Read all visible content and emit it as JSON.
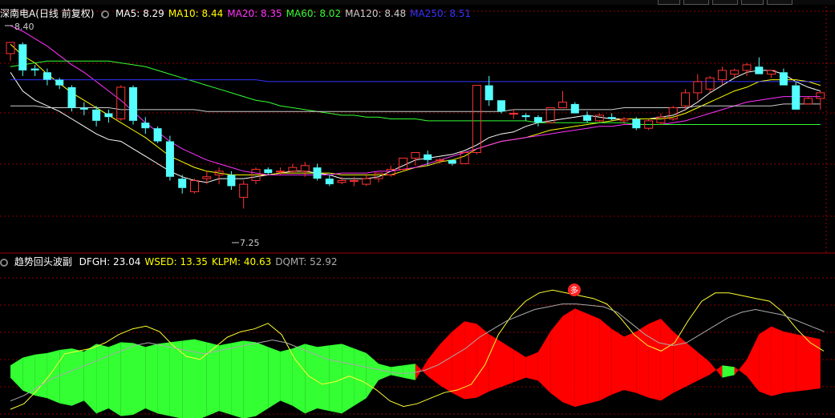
{
  "main_panel": {
    "title": "深南电A(日线 前复权)",
    "indicators": [
      {
        "label": "MA5: 8.29",
        "color": "#ffffff"
      },
      {
        "label": "MA10: 8.44",
        "color": "#ffff00"
      },
      {
        "label": "MA20: 8.35",
        "color": "#ff33ff"
      },
      {
        "label": "MA60: 8.02",
        "color": "#33ff33"
      },
      {
        "label": "MA120: 8.48",
        "color": "#cccccc"
      },
      {
        "label": "MA250: 8.51",
        "color": "#3333ff"
      }
    ],
    "high_label": "8.40",
    "low_label": "7.25"
  },
  "sub_panel": {
    "title": "趋势回头波副",
    "indicators": [
      {
        "label": "DFGH: 23.04",
        "color": "#ffffff"
      },
      {
        "label": "WSED: 13.35",
        "color": "#ffff00"
      },
      {
        "label": "KLPM: 40.63",
        "color": "#ffff00"
      },
      {
        "label": "DQMT: 52.92",
        "color": "#aaaaaa"
      }
    ],
    "marker_glyph": "多"
  },
  "colors": {
    "up": "#ff3333",
    "down": "#54ffff",
    "grid": "#8b0000",
    "pos_fill": "#ff0000",
    "neg_fill": "#33ff33"
  },
  "chart_data": {
    "type": "candlestick",
    "price_range": [
      7.25,
      8.4
    ],
    "candles": [
      [
        8.25,
        8.31,
        8.21,
        8.31
      ],
      [
        8.3,
        8.31,
        8.13,
        8.16
      ],
      [
        8.17,
        8.19,
        8.13,
        8.16
      ],
      [
        8.15,
        8.17,
        8.08,
        8.11
      ],
      [
        8.11,
        8.12,
        8.06,
        8.08
      ],
      [
        8.07,
        8.08,
        7.94,
        7.96
      ],
      [
        7.96,
        7.99,
        7.92,
        7.95
      ],
      [
        7.95,
        7.97,
        7.86,
        7.89
      ],
      [
        7.93,
        7.95,
        7.88,
        7.91
      ],
      [
        7.9,
        8.08,
        7.89,
        8.07
      ],
      [
        8.07,
        8.08,
        7.87,
        7.89
      ],
      [
        7.88,
        7.91,
        7.82,
        7.85
      ],
      [
        7.85,
        7.86,
        7.77,
        7.78
      ],
      [
        7.78,
        7.81,
        7.57,
        7.59
      ],
      [
        7.58,
        7.6,
        7.5,
        7.53
      ],
      [
        7.51,
        7.58,
        7.5,
        7.57
      ],
      [
        7.58,
        7.62,
        7.55,
        7.59
      ],
      [
        7.6,
        7.64,
        7.55,
        7.62
      ],
      [
        7.6,
        7.62,
        7.52,
        7.54
      ],
      [
        7.48,
        7.57,
        7.42,
        7.55
      ],
      [
        7.57,
        7.64,
        7.55,
        7.63
      ],
      [
        7.63,
        7.64,
        7.6,
        7.61
      ],
      [
        7.62,
        7.64,
        7.6,
        7.62
      ],
      [
        7.62,
        7.66,
        7.61,
        7.64
      ],
      [
        7.62,
        7.67,
        7.59,
        7.65
      ],
      [
        7.64,
        7.66,
        7.57,
        7.58
      ],
      [
        7.58,
        7.6,
        7.54,
        7.55
      ],
      [
        7.56,
        7.59,
        7.55,
        7.57
      ],
      [
        7.57,
        7.59,
        7.54,
        7.57
      ],
      [
        7.55,
        7.6,
        7.54,
        7.58
      ],
      [
        7.58,
        7.61,
        7.56,
        7.61
      ],
      [
        7.6,
        7.65,
        7.59,
        7.63
      ],
      [
        7.63,
        7.69,
        7.62,
        7.69
      ],
      [
        7.69,
        7.72,
        7.65,
        7.72
      ],
      [
        7.71,
        7.73,
        7.65,
        7.68
      ],
      [
        7.68,
        7.69,
        7.66,
        7.68
      ],
      [
        7.68,
        7.68,
        7.65,
        7.66
      ],
      [
        7.66,
        7.72,
        7.66,
        7.72
      ],
      [
        7.72,
        8.08,
        7.71,
        8.08
      ],
      [
        8.08,
        8.13,
        7.97,
        8.0
      ],
      [
        8.0,
        8.0,
        7.93,
        7.94
      ],
      [
        7.93,
        7.95,
        7.9,
        7.93
      ],
      [
        7.92,
        7.93,
        7.89,
        7.91
      ],
      [
        7.91,
        7.92,
        7.86,
        7.88
      ],
      [
        7.88,
        7.96,
        7.88,
        7.96
      ],
      [
        7.96,
        8.05,
        7.96,
        7.99
      ],
      [
        7.98,
        7.99,
        7.93,
        7.93
      ],
      [
        7.92,
        7.94,
        7.88,
        7.89
      ],
      [
        7.89,
        7.93,
        7.88,
        7.92
      ],
      [
        7.91,
        7.93,
        7.89,
        7.9
      ],
      [
        7.89,
        7.91,
        7.87,
        7.9
      ],
      [
        7.9,
        7.91,
        7.84,
        7.85
      ],
      [
        7.85,
        7.9,
        7.84,
        7.89
      ],
      [
        7.88,
        7.93,
        7.87,
        7.91
      ],
      [
        7.9,
        7.97,
        7.89,
        7.96
      ],
      [
        7.97,
        8.06,
        7.95,
        8.04
      ],
      [
        8.04,
        8.14,
        8.0,
        8.1
      ],
      [
        8.06,
        8.13,
        8.04,
        8.12
      ],
      [
        8.11,
        8.18,
        8.08,
        8.16
      ],
      [
        8.14,
        8.17,
        8.12,
        8.16
      ],
      [
        8.16,
        8.2,
        8.13,
        8.19
      ],
      [
        8.18,
        8.23,
        8.14,
        8.14
      ],
      [
        8.14,
        8.16,
        8.12,
        8.16
      ],
      [
        8.15,
        8.17,
        8.08,
        8.08
      ],
      [
        8.08,
        8.1,
        7.97,
        7.95
      ],
      [
        7.98,
        8.02,
        7.98,
        8.01
      ],
      [
        8.01,
        8.05,
        7.95,
        8.04
      ]
    ],
    "moving_averages": {
      "MA5": [
        8.15,
        8.05,
        8.0,
        7.97,
        7.94,
        7.9,
        7.86,
        7.82,
        7.79,
        7.78,
        7.74,
        7.7,
        7.66,
        7.62,
        7.59,
        7.57,
        7.56,
        7.58,
        7.58,
        7.58,
        7.59,
        7.6,
        7.61,
        7.62,
        7.62,
        7.61,
        7.6,
        7.58,
        7.58,
        7.58,
        7.59,
        7.62,
        7.65,
        7.68,
        7.69,
        7.7,
        7.71,
        7.73,
        7.76,
        7.8,
        7.82,
        7.83,
        7.86,
        7.88,
        7.89,
        7.9,
        7.91,
        7.92,
        7.91,
        7.9,
        7.9,
        7.9,
        7.9,
        7.91,
        7.92,
        7.95,
        7.99,
        8.04,
        8.08,
        8.12,
        8.15,
        8.16,
        8.16,
        8.14,
        8.1,
        8.07,
        8.05
      ],
      "MA10": [
        8.3,
        8.24,
        8.2,
        8.14,
        8.09,
        8.04,
        8.0,
        7.96,
        7.92,
        7.88,
        7.84,
        7.8,
        7.75,
        7.7,
        7.67,
        7.64,
        7.62,
        7.61,
        7.6,
        7.6,
        7.6,
        7.6,
        7.61,
        7.61,
        7.61,
        7.61,
        7.61,
        7.6,
        7.6,
        7.6,
        7.6,
        7.6,
        7.62,
        7.64,
        7.65,
        7.67,
        7.68,
        7.7,
        7.74,
        7.76,
        7.78,
        7.79,
        7.8,
        7.82,
        7.84,
        7.85,
        7.86,
        7.87,
        7.88,
        7.89,
        7.9,
        7.9,
        7.9,
        7.9,
        7.91,
        7.93,
        7.96,
        7.99,
        8.02,
        8.05,
        8.07,
        8.1,
        8.11,
        8.11,
        8.11,
        8.1,
        8.08
      ],
      "MA20": [
        8.4,
        8.37,
        8.33,
        8.29,
        8.24,
        8.19,
        8.15,
        8.1,
        8.05,
        8.0,
        7.94,
        7.88,
        7.83,
        7.78,
        7.74,
        7.71,
        7.68,
        7.66,
        7.64,
        7.62,
        7.61,
        7.6,
        7.6,
        7.6,
        7.6,
        7.6,
        7.6,
        7.61,
        7.61,
        7.61,
        7.62,
        7.62,
        7.63,
        7.64,
        7.66,
        7.68,
        7.7,
        7.72,
        7.74,
        7.76,
        7.78,
        7.79,
        7.8,
        7.81,
        7.82,
        7.83,
        7.84,
        7.85,
        7.86,
        7.86,
        7.87,
        7.87,
        7.87,
        7.87,
        7.88,
        7.89,
        7.91,
        7.93,
        7.95,
        7.97,
        7.99,
        8.0,
        8.01,
        8.02,
        8.02,
        8.02,
        8.02
      ],
      "MA60": [
        8.18,
        8.19,
        8.2,
        8.21,
        8.21,
        8.21,
        8.21,
        8.21,
        8.21,
        8.2,
        8.19,
        8.18,
        8.16,
        8.14,
        8.12,
        8.1,
        8.08,
        8.06,
        8.04,
        8.02,
        8.0,
        7.99,
        7.97,
        7.96,
        7.95,
        7.94,
        7.93,
        7.92,
        7.92,
        7.91,
        7.91,
        7.9,
        7.9,
        7.9,
        7.89,
        7.89,
        7.89,
        7.89,
        7.89,
        7.89,
        7.89,
        7.89,
        7.89,
        7.88,
        7.88,
        7.88,
        7.88,
        7.88,
        7.88,
        7.88,
        7.88,
        7.87,
        7.87,
        7.87,
        7.87,
        7.87,
        7.87,
        7.87,
        7.87,
        7.87,
        7.87,
        7.87,
        7.87,
        7.87,
        7.87,
        7.87,
        7.87
      ],
      "MA120": [
        7.97,
        7.97,
        7.97,
        7.96,
        7.96,
        7.96,
        7.96,
        7.96,
        7.96,
        7.95,
        7.95,
        7.95,
        7.95,
        7.95,
        7.95,
        7.95,
        7.94,
        7.94,
        7.94,
        7.94,
        7.94,
        7.94,
        7.94,
        7.94,
        7.94,
        7.94,
        7.94,
        7.94,
        7.94,
        7.94,
        7.94,
        7.94,
        7.94,
        7.94,
        7.94,
        7.94,
        7.94,
        7.94,
        7.94,
        7.94,
        7.94,
        7.95,
        7.95,
        7.95,
        7.95,
        7.95,
        7.95,
        7.95,
        7.95,
        7.95,
        7.96,
        7.96,
        7.96,
        7.96,
        7.96,
        7.96,
        7.97,
        7.97,
        7.97,
        7.97,
        7.97,
        7.97,
        7.97,
        7.98,
        7.98,
        7.98,
        7.98
      ],
      "MA250": [
        8.11,
        8.11,
        8.11,
        8.11,
        8.11,
        8.11,
        8.11,
        8.11,
        8.11,
        8.11,
        8.11,
        8.11,
        8.11,
        8.11,
        8.11,
        8.11,
        8.11,
        8.11,
        8.11,
        8.11,
        8.11,
        8.1,
        8.1,
        8.1,
        8.1,
        8.1,
        8.1,
        8.1,
        8.1,
        8.1,
        8.1,
        8.1,
        8.1,
        8.1,
        8.1,
        8.1,
        8.1,
        8.1,
        8.1,
        8.1,
        8.1,
        8.1,
        8.1,
        8.1,
        8.1,
        8.1,
        8.1,
        8.1,
        8.1,
        8.1,
        8.1,
        8.1,
        8.1,
        8.1,
        8.1,
        8.1,
        8.1,
        8.1,
        8.1,
        8.1,
        8.1,
        8.1,
        8.1,
        8.1,
        8.1,
        8.1,
        8.1
      ]
    },
    "oscillator": {
      "range": [
        0,
        100
      ],
      "histogram": [
        -6,
        -16,
        -20,
        -22,
        -26,
        -28,
        -24,
        -34,
        -30,
        -36,
        -35,
        -30,
        -34,
        -36,
        -38,
        -40,
        -36,
        -32,
        -35,
        -38,
        -36,
        -30,
        -24,
        -28,
        -34,
        -30,
        -32,
        -34,
        -28,
        -22,
        -8,
        -4,
        -6,
        -8,
        8,
        20,
        30,
        38,
        36,
        28,
        22,
        16,
        10,
        14,
        30,
        42,
        48,
        44,
        40,
        32,
        26,
        30,
        36,
        40,
        30,
        22,
        14,
        6,
        -6,
        -4,
        8,
        28,
        34,
        30,
        28,
        26,
        24
      ],
      "WSED": [
        4,
        8,
        18,
        30,
        44,
        46,
        48,
        52,
        58,
        62,
        64,
        60,
        50,
        42,
        40,
        48,
        56,
        60,
        62,
        66,
        58,
        40,
        28,
        22,
        24,
        28,
        24,
        18,
        10,
        6,
        8,
        12,
        16,
        18,
        22,
        36,
        58,
        72,
        82,
        88,
        90,
        88,
        86,
        84,
        80,
        70,
        58,
        50,
        46,
        52,
        68,
        82,
        88,
        88,
        86,
        84,
        82,
        74,
        62,
        52,
        46
      ],
      "DQMT": [
        10,
        14,
        20,
        26,
        30,
        34,
        38,
        42,
        46,
        50,
        52,
        50,
        48,
        46,
        44,
        46,
        48,
        50,
        52,
        54,
        52,
        48,
        44,
        40,
        38,
        36,
        34,
        32,
        30,
        30,
        32,
        36,
        42,
        48,
        56,
        62,
        68,
        72,
        76,
        78,
        80,
        80,
        79,
        78,
        74,
        66,
        58,
        52,
        50,
        52,
        58,
        64,
        70,
        74,
        76,
        74,
        72,
        68,
        64,
        60
      ]
    }
  }
}
